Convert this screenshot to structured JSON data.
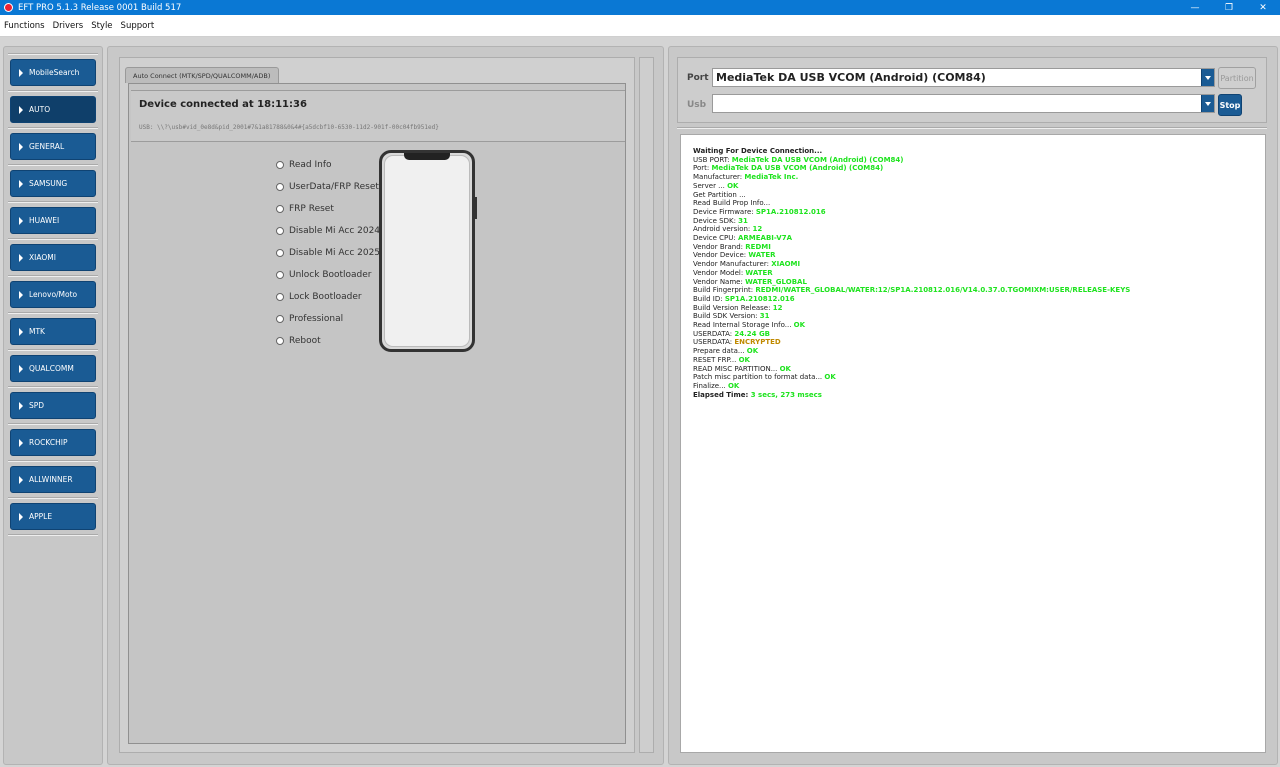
{
  "window": {
    "title": "EFT PRO 5.1.3 Release 0001 Build 517"
  },
  "menu": [
    "Functions",
    "Drivers",
    "Style",
    "Support"
  ],
  "sidebar": {
    "items": [
      {
        "label": "MobileSearch",
        "active": false
      },
      {
        "label": "AUTO",
        "active": true
      },
      {
        "label": "GENERAL",
        "active": false
      },
      {
        "label": "SAMSUNG",
        "active": false
      },
      {
        "label": "HUAWEI",
        "active": false
      },
      {
        "label": "XIAOMI",
        "active": false
      },
      {
        "label": "Lenovo/Moto",
        "active": false
      },
      {
        "label": "MTK",
        "active": false
      },
      {
        "label": "QUALCOMM",
        "active": false
      },
      {
        "label": "SPD",
        "active": false
      },
      {
        "label": "ROCKCHIP",
        "active": false
      },
      {
        "label": "ALLWINNER",
        "active": false
      },
      {
        "label": "APPLE",
        "active": false
      }
    ]
  },
  "center": {
    "tab_label": "Auto Connect (MTK/SPD/QUALCOMM/ADB)",
    "device_title": "Device connected at 18:11:36",
    "device_usb": "USB: \\\\?\\usb#vid_0e8d&pid_2001#7&1a81788&0&4#{a5dcbf10-6530-11d2-901f-00c04fb951ed}",
    "options": [
      "Read Info",
      "UserData/FRP Reset",
      "FRP Reset",
      "Disable Mi Acc 2024",
      "Disable Mi Acc 2025",
      "Unlock Bootloader",
      "Lock Bootloader",
      "Professional",
      "Reboot"
    ]
  },
  "right": {
    "port_label": "Port",
    "port_value": "MediaTek DA USB VCOM (Android) (COM84)",
    "usb_label": "Usb",
    "usb_value": "",
    "partition_label": "Partition",
    "stop_label": "Stop",
    "log": [
      {
        "k": "Waiting For Device Connection...",
        "v": "",
        "bold": true
      },
      {
        "k": "USB PORT: ",
        "v": "MediaTek DA USB VCOM (Android) (COM84)"
      },
      {
        "k": "Port: ",
        "v": "MediaTek DA USB VCOM (Android) (COM84)"
      },
      {
        "k": "Manufacturer: ",
        "v": "MediaTek Inc."
      },
      {
        "k": "Server ... ",
        "v": "OK"
      },
      {
        "k": "Get Partition ...",
        "v": ""
      },
      {
        "k": "Read Build Prop Info...",
        "v": ""
      },
      {
        "k": " Device Firmware: ",
        "v": "SP1A.210812.016"
      },
      {
        "k": " Device SDK: ",
        "v": "31"
      },
      {
        "k": " Android version: ",
        "v": "12"
      },
      {
        "k": " Device CPU: ",
        "v": "ARMEABI-V7A"
      },
      {
        "k": " Vendor Brand: ",
        "v": "REDMI"
      },
      {
        "k": " Vendor Device: ",
        "v": "WATER"
      },
      {
        "k": " Vendor Manufacturer: ",
        "v": "XIAOMI"
      },
      {
        "k": " Vendor Model: ",
        "v": "WATER"
      },
      {
        "k": " Vendor Name: ",
        "v": "WATER_GLOBAL"
      },
      {
        "k": " Build Fingerprint: ",
        "v": "REDMI/WATER_GLOBAL/WATER:12/SP1A.210812.016/V14.0.37.0.TGOMIXM:USER/RELEASE-KEYS"
      },
      {
        "k": " Build ID: ",
        "v": "SP1A.210812.016"
      },
      {
        "k": " Build Version Release: ",
        "v": "12"
      },
      {
        "k": " Build SDK Version: ",
        "v": "31"
      },
      {
        "k": "Read Internal Storage Info... ",
        "v": "OK"
      },
      {
        "k": "USERDATA: ",
        "v": "24.24 GB"
      },
      {
        "k": "USERDATA: ",
        "v": "ENCRYPTED",
        "orange": true
      },
      {
        "k": "Prepare data... ",
        "v": "OK"
      },
      {
        "k": "RESET FRP... ",
        "v": "OK"
      },
      {
        "k": "READ MISC PARTITION... ",
        "v": "OK"
      },
      {
        "k": "Patch misc partition to format data... ",
        "v": "OK"
      },
      {
        "k": "Finalize... ",
        "v": "OK"
      },
      {
        "k": "Elapsed Time: ",
        "v": "3 secs, 273 msecs",
        "bold": true
      }
    ]
  },
  "colors": {
    "accent": "#1a5b94",
    "titlebar": "#0a78d4",
    "log_ok": "#1ee31e",
    "log_warn": "#c08a00"
  }
}
